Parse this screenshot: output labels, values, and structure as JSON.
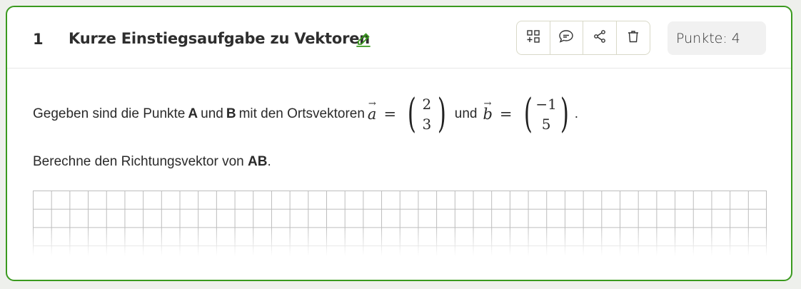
{
  "task": {
    "number": "1",
    "title": "Kurze Einstiegsaufgabe zu Vektoren",
    "points_label": "Punkte: 4"
  },
  "toolbar": {
    "buttons": [
      {
        "icon": "add-widget-icon"
      },
      {
        "icon": "comment-icon"
      },
      {
        "icon": "share-icon"
      },
      {
        "icon": "trash-icon"
      }
    ]
  },
  "content": {
    "statement": {
      "part1": "Gegeben sind die Punkte",
      "point_a": "A",
      "und1": "und",
      "point_b": "B",
      "part2": "mit den Ortsvektoren",
      "vec_a_name": "a",
      "vec_a": [
        "2",
        "3"
      ],
      "und2": "und",
      "vec_b_name": "b",
      "vec_b": [
        "−1",
        "5"
      ],
      "end": "."
    },
    "question": {
      "text": "Berechne den Richtungsvektor von",
      "bold": "AB",
      "end": "."
    }
  },
  "colors": {
    "accent": "#3a9a1e",
    "border": "#d9d9c8",
    "points_bg": "#f1f1f1"
  }
}
